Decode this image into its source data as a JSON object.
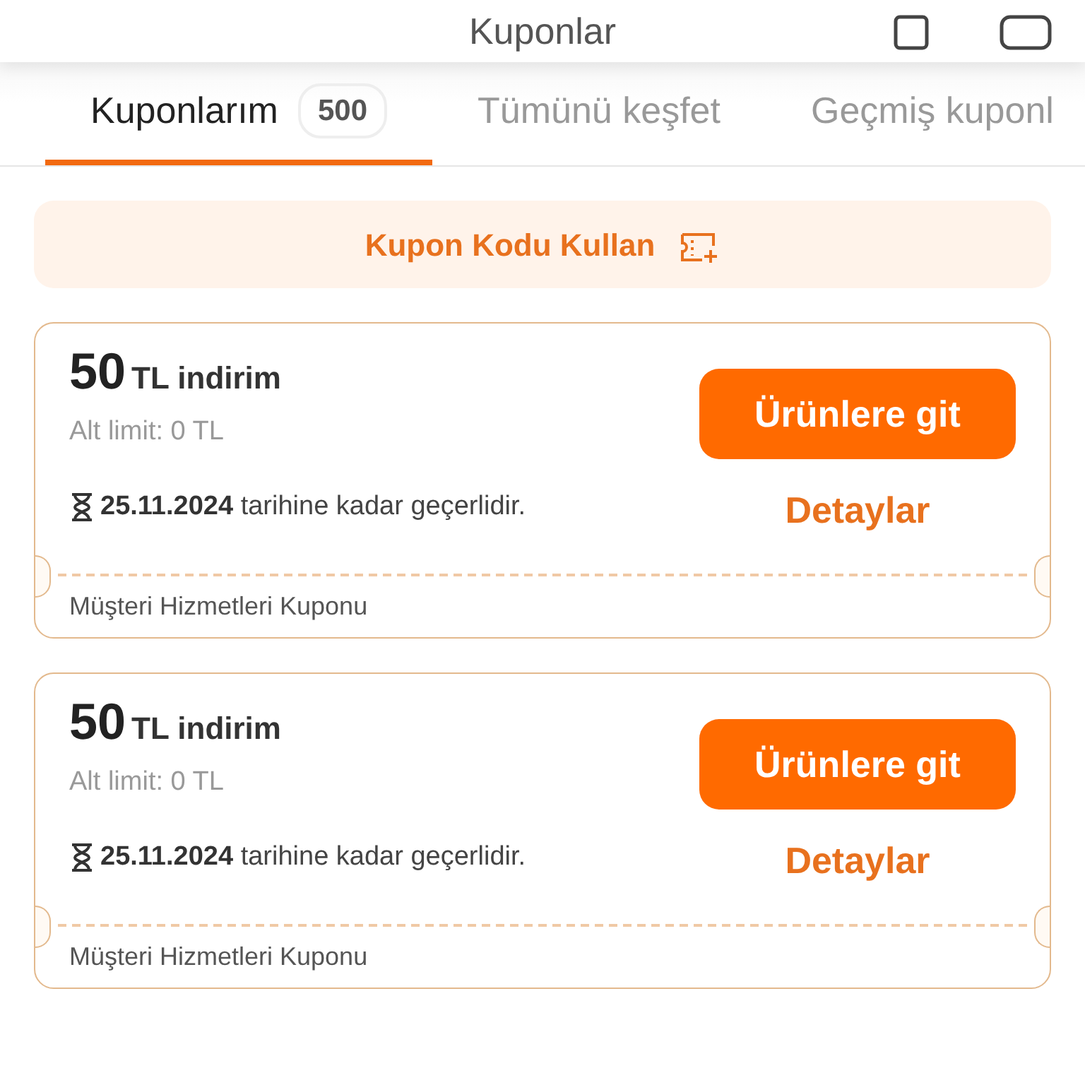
{
  "header": {
    "title": "Kuponlar"
  },
  "tabs": [
    {
      "label": "Kuponlarım",
      "count": "500",
      "selected": true
    },
    {
      "label": "Tümünü keşfet",
      "selected": false
    },
    {
      "label": "Geçmiş kuponl",
      "selected": false
    }
  ],
  "code_button": {
    "label": "Kupon Kodu Kullan"
  },
  "coupons": [
    {
      "amount": "50",
      "unit": "TL indirim",
      "limit": "Alt limit: 0 TL",
      "validity": "**25.11.2024** tarihine kadar geçerlidir.",
      "action": "Ürünlere git",
      "details": "Detaylar",
      "source": "Müşteri Hizmetleri Kuponu"
    },
    {
      "amount": "50",
      "unit": "TL indirim",
      "limit": "Alt limit: 0 TL",
      "validity": "**25.11.2024** tarihine kadar geçerlidir.",
      "action": "Ürünlere git",
      "details": "Detaylar",
      "source": "Müşteri Hizmetleri Kuponu"
    }
  ]
}
